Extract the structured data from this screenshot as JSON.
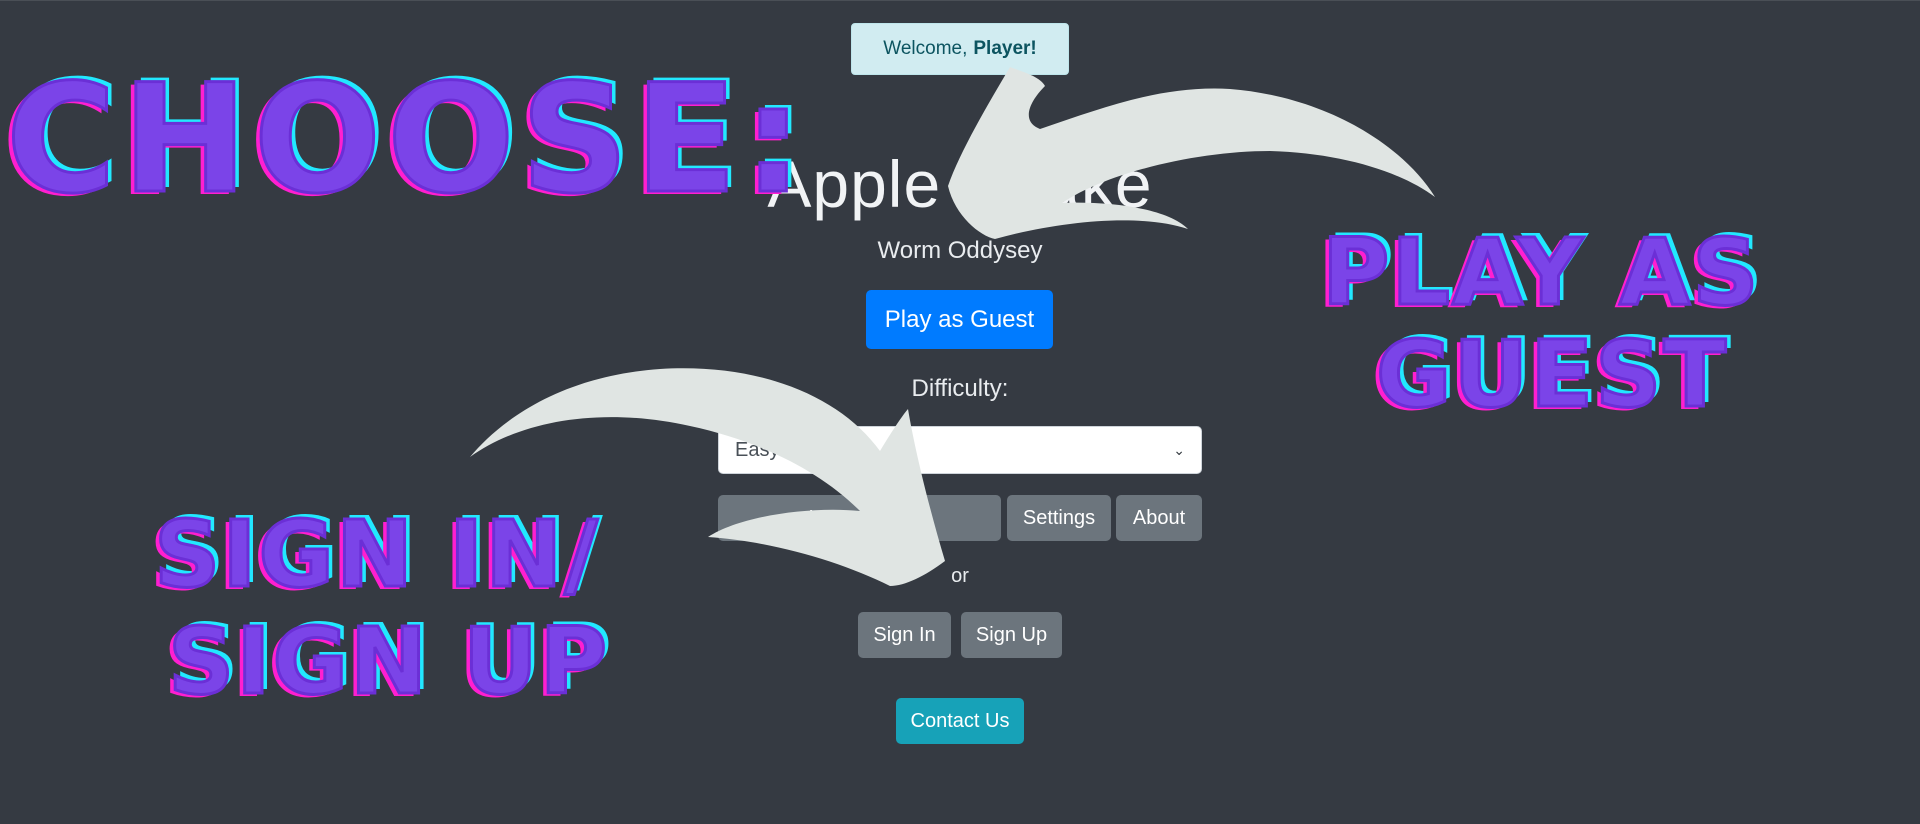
{
  "welcome": {
    "prefix": "Welcome,",
    "name": "Player!"
  },
  "app": {
    "title": "Apple Snake",
    "subtitle": "Worm Oddysey"
  },
  "buttons": {
    "play_guest": "Play as Guest",
    "how_to": "Instructions",
    "settings": "Settings",
    "about": "About",
    "sign_in": "Sign In",
    "sign_up": "Sign Up",
    "contact": "Contact Us"
  },
  "difficulty": {
    "label": "Difficulty:",
    "value": "Easy"
  },
  "or_text": "or",
  "annotations": {
    "choose": "CHOOSE:",
    "play_guest_line1": "PLAY AS",
    "play_guest_line2": "GUEST",
    "sign_line1": "SIGN IN/",
    "sign_line2": "SIGN UP"
  },
  "colors": {
    "background": "#353a42",
    "primary": "#007bff",
    "secondary": "#6c757d",
    "info": "#17a2b8",
    "annotation_fill": "#7b44e8",
    "annotation_shadow_pink": "#ff1fd0",
    "annotation_shadow_cyan": "#22e8ff",
    "arrow": "#e0e5e3"
  }
}
